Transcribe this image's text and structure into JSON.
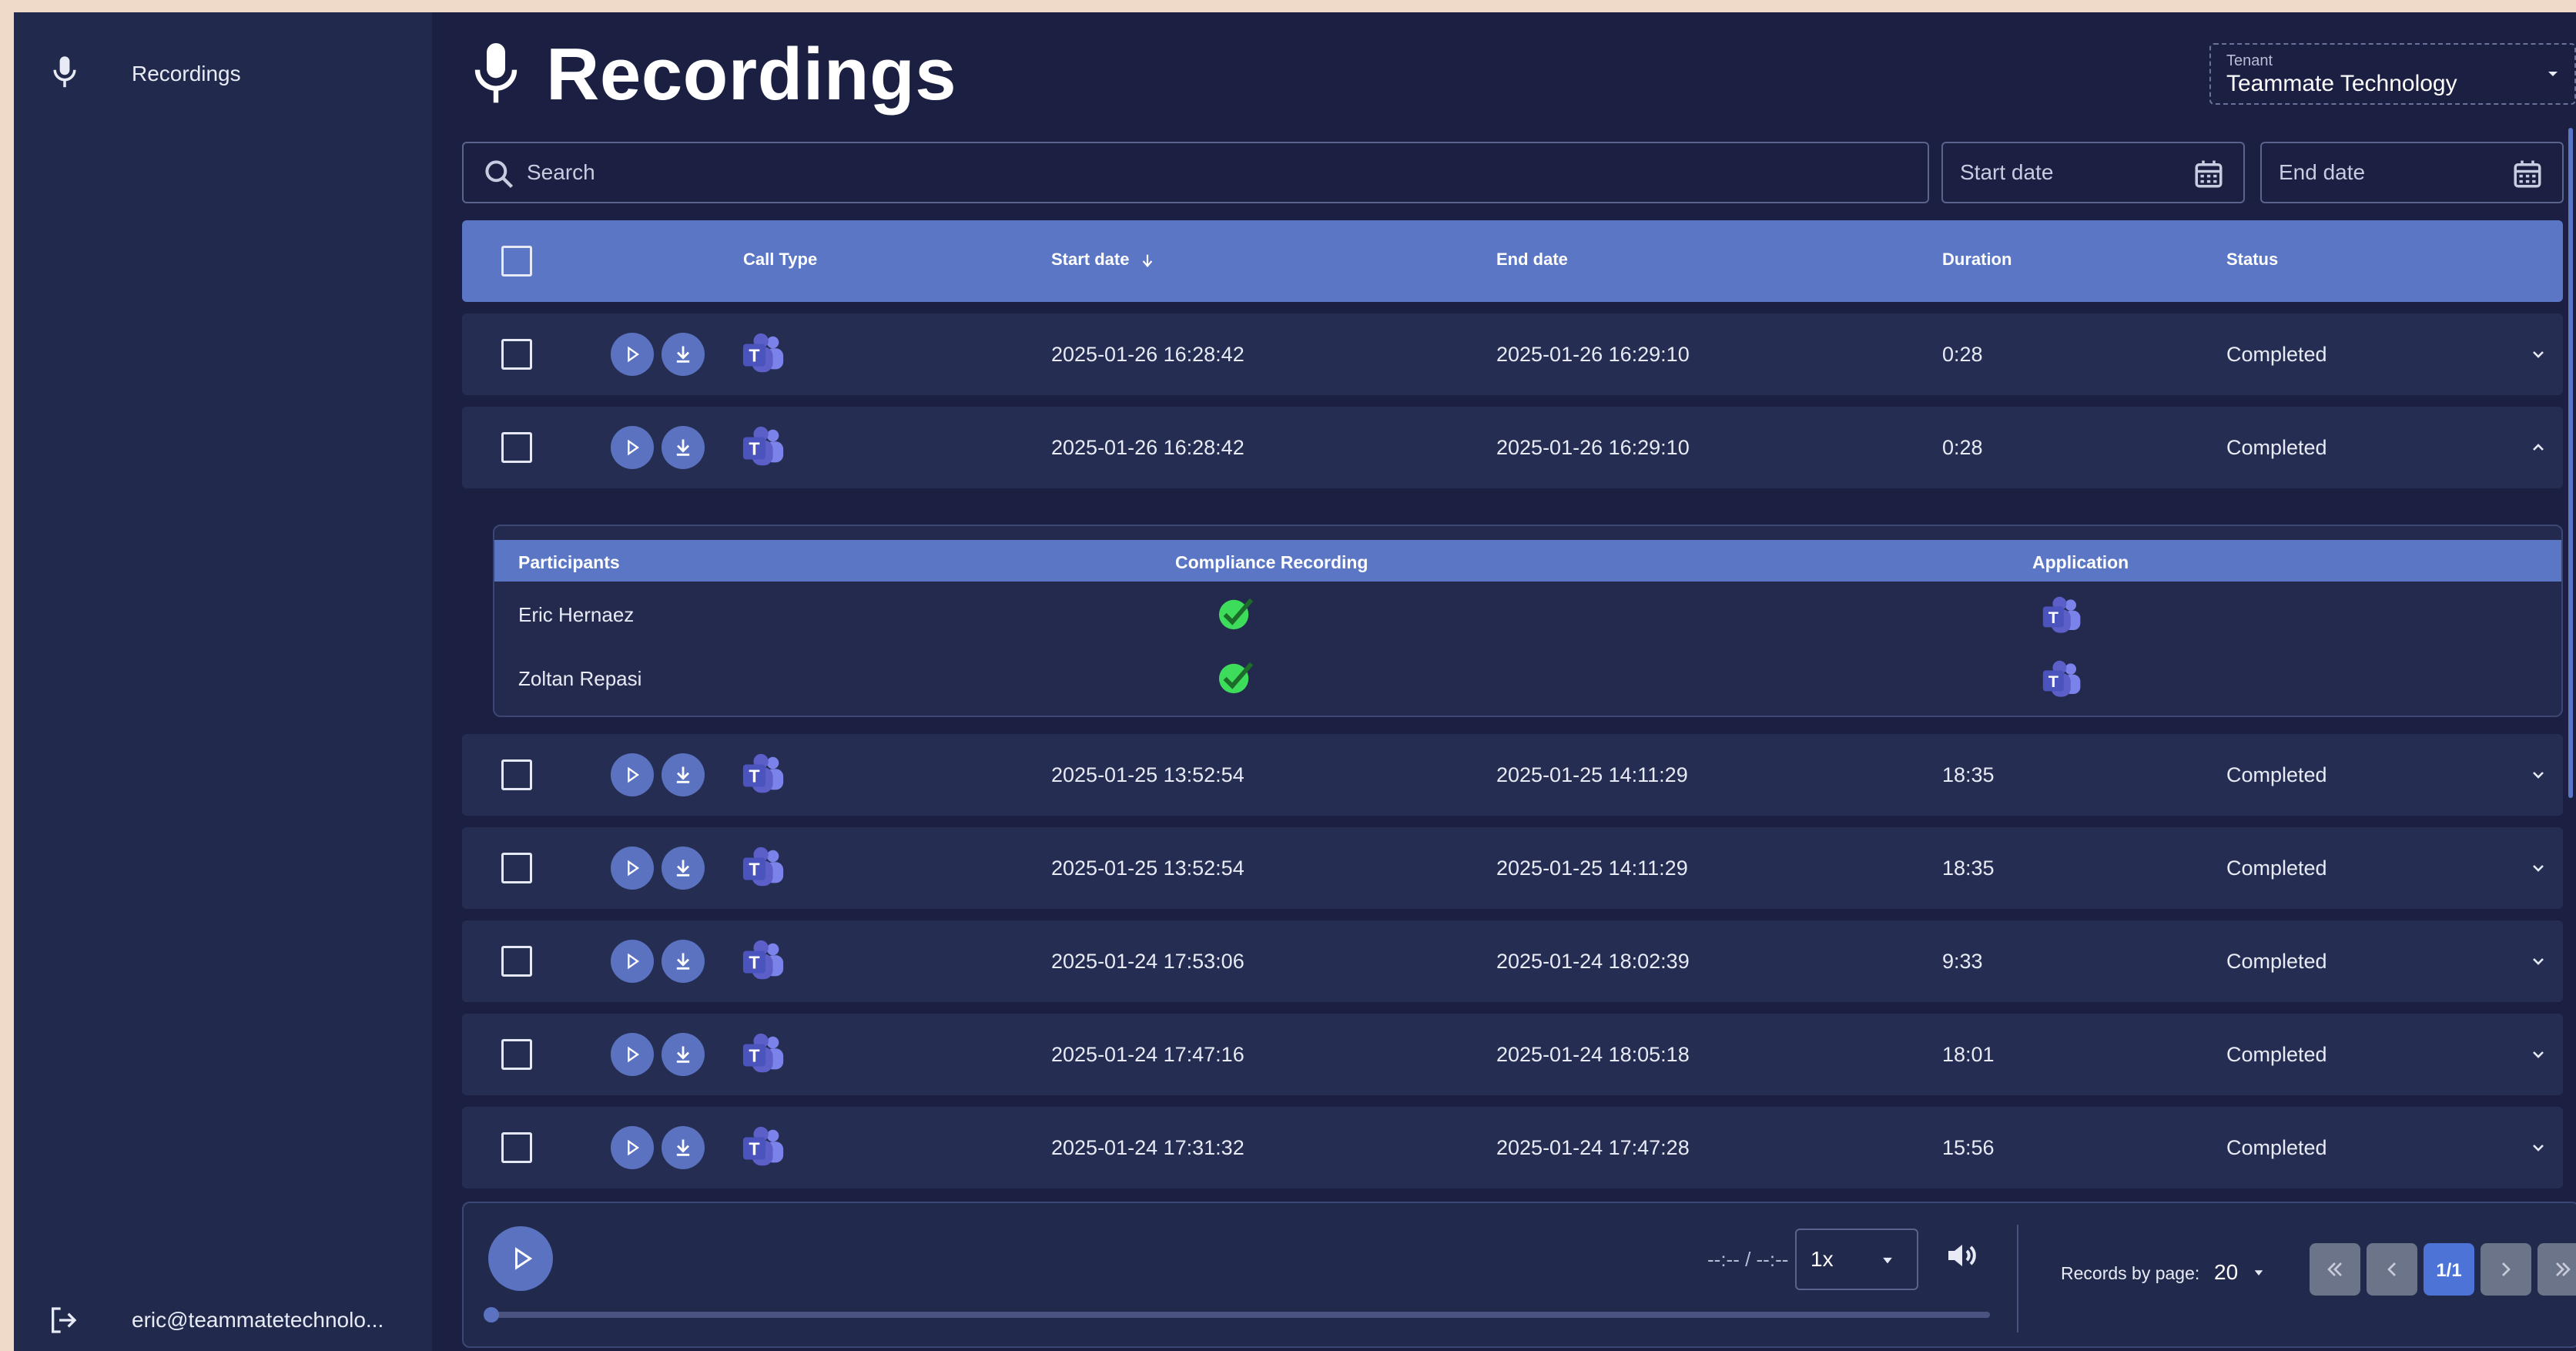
{
  "sidebar": {
    "items": [
      {
        "label": "Recordings",
        "icon": "microphone-icon"
      }
    ],
    "user": {
      "label": "eric@teammatetechnolo...",
      "icon": "logout-icon"
    }
  },
  "header": {
    "title": "Recordings",
    "title_icon": "microphone-icon",
    "tenant": {
      "label": "Tenant",
      "value": "Teammate Technology"
    }
  },
  "filters": {
    "search_placeholder": "Search",
    "start_date_placeholder": "Start date",
    "end_date_placeholder": "End date"
  },
  "table": {
    "columns": {
      "call_type": "Call Type",
      "start_date": "Start date",
      "end_date": "End date",
      "duration": "Duration",
      "status": "Status"
    },
    "rows": [
      {
        "start": "2025-01-26 16:28:42",
        "end": "2025-01-26 16:29:10",
        "duration": "0:28",
        "status": "Completed",
        "expanded": false
      },
      {
        "start": "2025-01-26 16:28:42",
        "end": "2025-01-26 16:29:10",
        "duration": "0:28",
        "status": "Completed",
        "expanded": true
      },
      {
        "start": "2025-01-25 13:52:54",
        "end": "2025-01-25 14:11:29",
        "duration": "18:35",
        "status": "Completed",
        "expanded": false
      },
      {
        "start": "2025-01-25 13:52:54",
        "end": "2025-01-25 14:11:29",
        "duration": "18:35",
        "status": "Completed",
        "expanded": false
      },
      {
        "start": "2025-01-24 17:53:06",
        "end": "2025-01-24 18:02:39",
        "duration": "9:33",
        "status": "Completed",
        "expanded": false
      },
      {
        "start": "2025-01-24 17:47:16",
        "end": "2025-01-24 18:05:18",
        "duration": "18:01",
        "status": "Completed",
        "expanded": false
      },
      {
        "start": "2025-01-24 17:31:32",
        "end": "2025-01-24 17:47:28",
        "duration": "15:56",
        "status": "Completed",
        "expanded": false
      }
    ],
    "expanded_detail": {
      "columns": {
        "participants": "Participants",
        "compliance": "Compliance Recording",
        "application": "Application"
      },
      "participants": [
        {
          "name": "Eric Hernaez",
          "compliance": true,
          "application": "teams-icon"
        },
        {
          "name": "Zoltan Repasi",
          "compliance": true,
          "application": "teams-icon"
        }
      ]
    }
  },
  "player": {
    "time": "--:-- / --:--",
    "speed": "1x",
    "progress": 0,
    "records_by_page_label": "Records by page:",
    "records_by_page_value": "20",
    "current_page": "1/1"
  },
  "colors": {
    "background": "#1b1f42",
    "sidebar": "#212a4d",
    "header_blue": "#5a76c4",
    "row": "#252e52",
    "accent": "#4e73d6",
    "check_green": "#2ecc40"
  }
}
